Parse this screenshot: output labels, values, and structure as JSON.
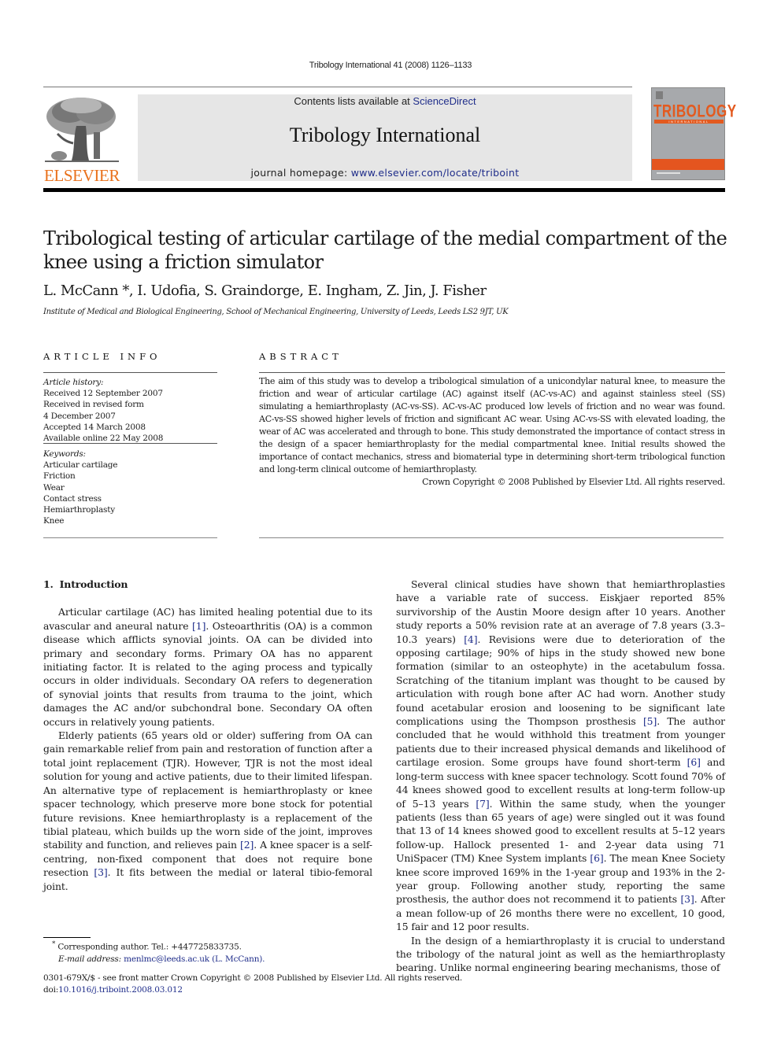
{
  "header": {
    "citation": "Tribology International 41 (2008) 1126–1133",
    "contents_prefix": "Contents lists available at ",
    "contents_link": "ScienceDirect",
    "journal_title": "Tribology International",
    "homepage_prefix": "journal homepage: ",
    "homepage_link": "www.elsevier.com/locate/triboint",
    "publisher_logo_text": "ELSEVIER",
    "cover_title": "TRIBOLOGY",
    "cover_subtitle": "INTERNATIONAL",
    "colors": {
      "publisher_orange": "#e9711c",
      "cover_orange": "#e4551f",
      "link_blue": "#1f2d8a",
      "masthead_gray": "#e6e6e6"
    }
  },
  "article": {
    "title": "Tribological testing of articular cartilage of the medial compartment of the knee using a friction simulator",
    "title_line1": "Tribological testing of articular cartilage of the medial compartment of the",
    "title_line2": "knee using a friction simulator",
    "authors": "L. McCann *, I. Udofia, S. Graindorge, E. Ingham, Z. Jin, J. Fisher",
    "affiliation": "Institute of Medical and Biological Engineering, School of Mechanical Engineering, University of Leeds, Leeds LS2 9JT, UK"
  },
  "article_info": {
    "heading": "ARTICLE INFO",
    "history_label": "Article history:",
    "history": [
      "Received 12 September 2007",
      "Received in revised form",
      "4 December 2007",
      "Accepted 14 March 2008",
      "Available online 22 May 2008"
    ],
    "keywords_label": "Keywords:",
    "keywords": [
      "Articular cartilage",
      "Friction",
      "Wear",
      "Contact stress",
      "Hemiarthroplasty",
      "Knee"
    ]
  },
  "abstract": {
    "heading": "ABSTRACT",
    "text": "The aim of this study was to develop a tribological simulation of a unicondylar natural knee, to measure the friction and wear of articular cartilage (AC) against itself (AC-vs-AC) and against stainless steel (SS) simulating a hemiarthroplasty (AC-vs-SS). AC-vs-AC produced low levels of friction and no wear was found. AC-vs-SS showed higher levels of friction and significant AC wear. Using AC-vs-SS with elevated loading, the wear of AC was accelerated and through to bone. This study demonstrated the importance of contact stress in the design of a spacer hemiarthroplasty for the medial compartmental knee. Initial results showed the importance of contact mechanics, stress and biomaterial type in determining short-term tribological function and long-term clinical outcome of hemiarthroplasty.",
    "copyright": "Crown Copyright © 2008 Published by Elsevier Ltd. All rights reserved."
  },
  "body": {
    "section_number": "1.",
    "section_title": "Introduction",
    "left_paragraphs": [
      {
        "parts": [
          {
            "t": "Articular cartilage (AC) has limited healing potential due to its avascular and aneural nature "
          },
          {
            "ref": "[1]"
          },
          {
            "t": ". Osteoarthritis (OA) is a common disease which afflicts synovial joints. OA can be divided into primary and secondary forms. Primary OA has no apparent initiating factor. It is related to the aging process and typically occurs in older individuals. Secondary OA refers to degeneration of synovial joints that results from trauma to the joint, which damages the AC and/or subchondral bone. Secondary OA often occurs in relatively young patients."
          }
        ]
      },
      {
        "parts": [
          {
            "t": "Elderly patients (65 years old or older) suffering from OA can gain remarkable relief from pain and restoration of function after a total joint replacement (TJR). However, TJR is not the most ideal solution for young and active patients, due to their limited lifespan. An alternative type of replacement is hemiarthroplasty or knee spacer technology, which preserve more bone stock for potential future revisions. Knee hemiarthroplasty is a replacement of the tibial plateau, which builds up the worn side of the joint, improves stability and function, and relieves pain "
          },
          {
            "ref": "[2]"
          },
          {
            "t": ". A knee spacer is a self-centring, non-fixed component that does not require bone resection "
          },
          {
            "ref": "[3]"
          },
          {
            "t": ". It fits between the medial or lateral tibio-femoral joint."
          }
        ]
      }
    ],
    "right_paragraphs": [
      {
        "parts": [
          {
            "t": "Several clinical studies have shown that hemiarthroplasties have a variable rate of success. Eiskjaer reported 85% survivorship of the Austin Moore design after 10 years. Another study reports a 50% revision rate at an average of 7.8 years (3.3–10.3 years) "
          },
          {
            "ref": "[4]"
          },
          {
            "t": ". Revisions were due to deterioration of the opposing cartilage; 90% of hips in the study showed new bone formation (similar to an osteophyte) in the acetabulum fossa. Scratching of the titanium implant was thought to be caused by articulation with rough bone after AC had worn. Another study found acetabular erosion and loosening to be significant late complications using the Thompson prosthesis "
          },
          {
            "ref": "[5]"
          },
          {
            "t": ". The author concluded that he would withhold this treatment from younger patients due to their increased physical demands and likelihood of cartilage erosion. Some groups have found short-term "
          },
          {
            "ref": "[6]"
          },
          {
            "t": " and long-term success with knee spacer technology. Scott found 70% of 44 knees showed good to excellent results at long-term follow-up of 5–13 years "
          },
          {
            "ref": "[7]"
          },
          {
            "t": ". Within the same study, when the younger patients (less than 65 years of age) were singled out it was found that 13 of 14 knees showed good to excellent results at 5–12 years follow-up. Hallock presented 1- and 2-year data using 71 UniSpacer (TM) Knee System implants "
          },
          {
            "ref": "[6]"
          },
          {
            "t": ". The mean Knee Society knee score improved 169% in the 1-year group and 193% in the 2-year group. Following another study, reporting the same prosthesis, the author does not recommend it to patients "
          },
          {
            "ref": "[3]"
          },
          {
            "t": ". After a mean follow-up of 26 months there were no excellent, 10 good, 15 fair and 12 poor results."
          }
        ]
      },
      {
        "parts": [
          {
            "t": "In the design of a hemiarthroplasty it is crucial to understand the tribology of the natural joint as well as the hemiarthroplasty bearing. Unlike normal engineering bearing mechanisms, those of"
          }
        ]
      }
    ]
  },
  "footnote": {
    "marker": "*",
    "corresponding": " Corresponding author. Tel.: +447725833735.",
    "email_label": "E-mail address: ",
    "email": "menlmc@leeds.ac.uk",
    "email_name": " (L. McCann)."
  },
  "footer": {
    "issn_line": "0301-679X/$ - see front matter Crown Copyright © 2008 Published by Elsevier Ltd. All rights reserved.",
    "doi_label": "doi:",
    "doi": "10.1016/j.triboint.2008.03.012"
  }
}
